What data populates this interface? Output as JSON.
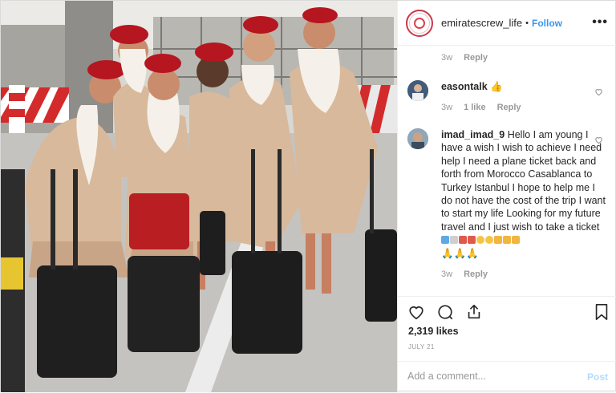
{
  "post": {
    "photo_alt": "Six Emirates cabin crew members with suitcases",
    "header": {
      "username": "emiratescrew_life",
      "separator": "•",
      "follow_label": "Follow",
      "more_label": "•••"
    },
    "comments": [
      {
        "time": "3w",
        "reply_label": "Reply"
      },
      {
        "username": "easontalk",
        "text": "👍",
        "time": "3w",
        "likes": "1 like",
        "reply_label": "Reply"
      },
      {
        "username": "imad_imad_9",
        "text": "Hello I am young I have a wish I wish to achieve I need help I need a plane ticket back and forth from Morocco Casablanca to Turkey Istanbul I hope to help me I do not have the cost of the trip I want to start my life Looking for my future travel and I just wish to take a ticket",
        "emoji_line": "🙏🙏🙏",
        "time": "3w",
        "reply_label": "Reply"
      }
    ],
    "likes_text": "2,319 likes",
    "date_text": "JULY 21",
    "add_comment_placeholder": "Add a comment...",
    "post_label": "Post"
  },
  "colors": {
    "link": "#3897f0",
    "muted": "#999999",
    "border": "#efefef",
    "text": "#262626",
    "uniform": "#d6b79a",
    "hat": "#c0202d"
  },
  "icons": [
    "heart-icon",
    "comment-icon",
    "share-icon",
    "bookmark-icon",
    "more-icon"
  ]
}
